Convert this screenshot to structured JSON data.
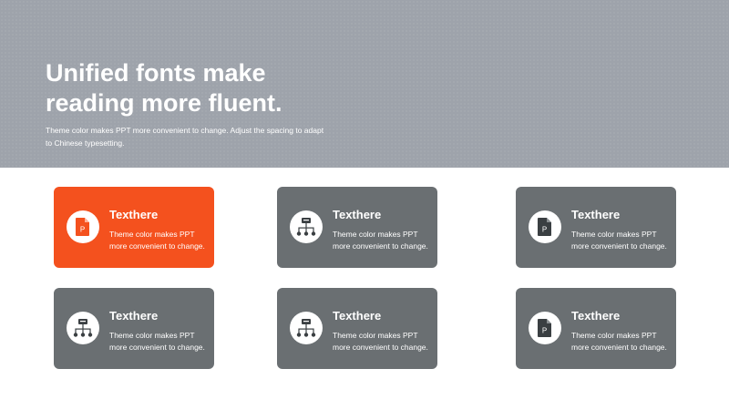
{
  "hero": {
    "title_line1": "Unified fonts make",
    "title_line2": "reading more fluent.",
    "subtitle_line1": "Theme color makes PPT more convenient to change. Adjust the spacing to adapt",
    "subtitle_line2": "to Chinese  typesetting."
  },
  "colors": {
    "hero_bg": "#9ea3ab",
    "accent": "#f4511e",
    "card": "#6a6f72",
    "icon_dark": "#3a3f42"
  },
  "cards": [
    {
      "title": "Texthere",
      "line1": "Theme color makes PPT",
      "line2": "more convenient  to change.",
      "icon": "document-p-icon",
      "icon_letter": "P",
      "accent": true
    },
    {
      "title": "Texthere",
      "line1": "Theme color makes PPT",
      "line2": "more convenient  to change.",
      "icon": "hierarchy-icon",
      "accent": false
    },
    {
      "title": "Texthere",
      "line1": "Theme color makes PPT",
      "line2": "more convenient  to change.",
      "icon": "document-p-icon",
      "icon_letter": "P",
      "accent": false
    },
    {
      "title": "Texthere",
      "line1": "Theme color makes PPT",
      "line2": "more convenient  to change.",
      "icon": "hierarchy-icon",
      "accent": false
    },
    {
      "title": "Texthere",
      "line1": "Theme color makes PPT",
      "line2": "more convenient  to change.",
      "icon": "hierarchy-icon",
      "accent": false
    },
    {
      "title": "Texthere",
      "line1": "Theme color makes PPT",
      "line2": "more convenient  to change.",
      "icon": "document-p-icon",
      "icon_letter": "P",
      "accent": false
    }
  ]
}
